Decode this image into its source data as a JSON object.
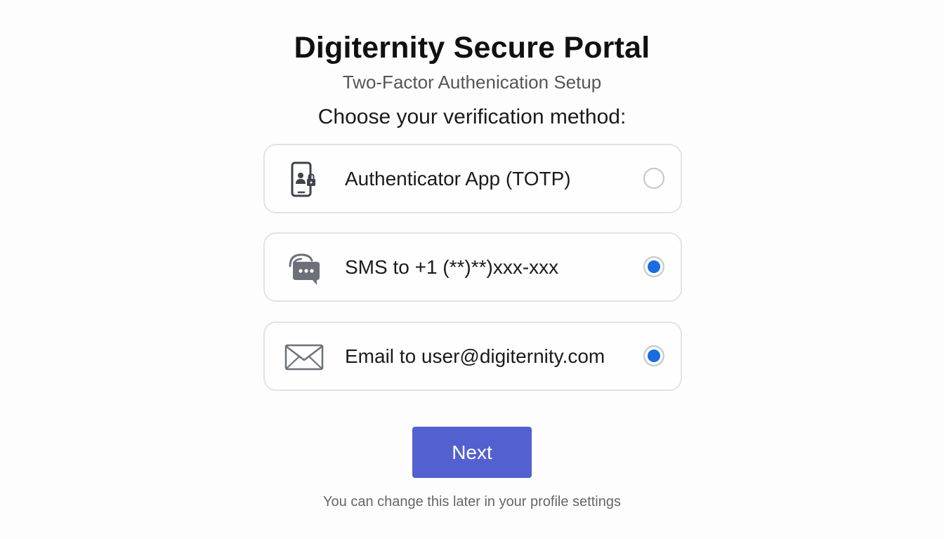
{
  "header": {
    "title": "Digiternity Secure Portal",
    "subtitle": "Two-Factor Authenication Setup"
  },
  "prompt": "Choose your verification method:",
  "options": [
    {
      "label": "Authenticator App (TOTP)",
      "icon": "phone-lock-icon",
      "selected": false
    },
    {
      "label": "SMS to +1 (**)**)xxx-xxx",
      "icon": "chat-bubble-icon",
      "selected": true
    },
    {
      "label": "Email to user@digiternity.com",
      "icon": "envelope-icon",
      "selected": true
    }
  ],
  "actions": {
    "next_label": "Next"
  },
  "footnote": "You can change this later in your profile settings",
  "colors": {
    "accent": "#5360cf",
    "radio_selected": "#1a6ce0",
    "icon": "#4a4e57"
  }
}
